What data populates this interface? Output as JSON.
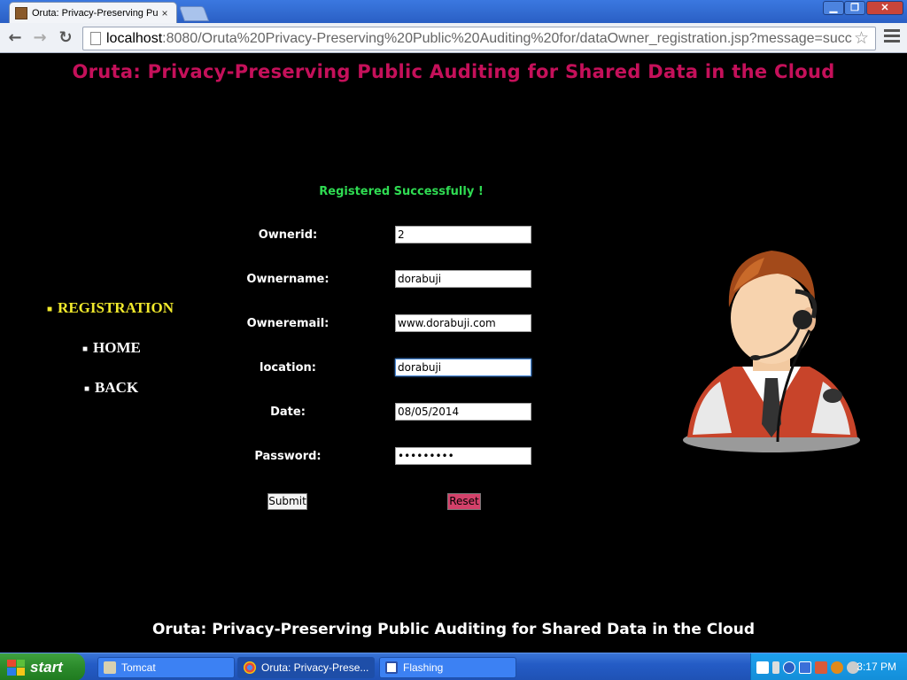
{
  "browser": {
    "tab_title": "Oruta: Privacy-Preserving Pu",
    "tab_close": "×",
    "url_host": "localhost",
    "url_path": ":8080/Oruta%20Privacy-Preserving%20Public%20Auditing%20for/dataOwner_registration.jsp?message=succ",
    "window_controls": {
      "min": "▁",
      "max": "❐",
      "close": "✕"
    },
    "nav": {
      "back": "←",
      "forward": "→",
      "reload": "↻"
    },
    "star": "☆"
  },
  "page": {
    "header_title": "Oruta: Privacy-Preserving Public Auditing for Shared Data in the Cloud",
    "message": "Registered Successfully !",
    "nav": {
      "registration": "REGISTRATION",
      "home": "HOME",
      "back": "BACK",
      "active_color": "#f2ea2c"
    },
    "form": {
      "ownerid_label": "Ownerid:",
      "ownerid_value": "2",
      "ownername_label": "Ownername:",
      "ownername_value": "dorabuji",
      "owneremail_label": "Owneremail:",
      "owneremail_value": "www.dorabuji.com",
      "location_label": "location:",
      "location_value": "dorabuji",
      "date_label": "Date:",
      "date_value": "08/05/2014",
      "password_label": "Password:",
      "password_value": "•••••••••",
      "submit_label": "Submit",
      "reset_label": "Reset"
    },
    "footer_title": "Oruta: Privacy-Preserving Public Auditing for Shared Data in the Cloud",
    "colors": {
      "title": "#c5105a",
      "message": "#2fdc52",
      "reset_bg": "#d3416a"
    }
  },
  "taskbar": {
    "start": "start",
    "tasks": [
      {
        "label": "Tomcat",
        "icon": "tomcat-icon"
      },
      {
        "label": "Oruta: Privacy-Prese...",
        "icon": "chrome-icon"
      },
      {
        "label": "Flashing",
        "icon": "flashing-icon"
      }
    ],
    "clock": "3:17 PM"
  }
}
